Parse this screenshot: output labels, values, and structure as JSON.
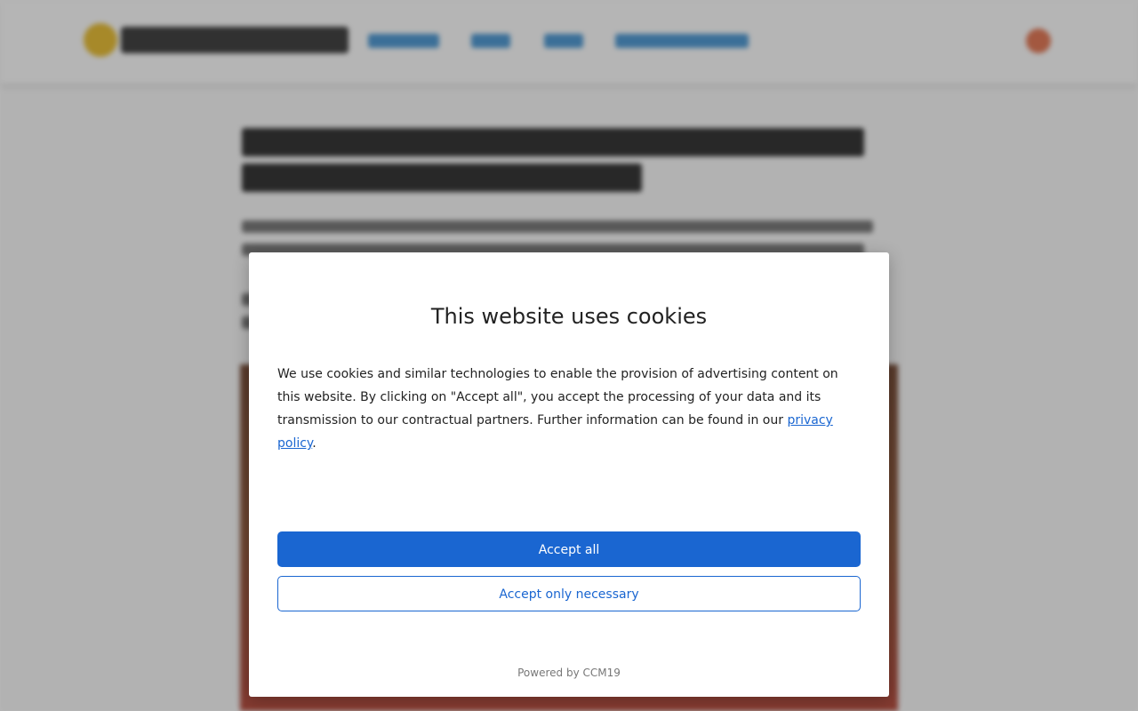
{
  "cookie_dialog": {
    "title": "This website uses cookies",
    "body_text": "We use cookies and similar technologies to enable the provision of advertising content on this website. By clicking on \"Accept all\", you accept the processing of your data and its transmission to our contractual partners. Further information can be found in our ",
    "privacy_link": "privacy policy",
    "body_end": ".",
    "accept_all_label": "Accept all",
    "accept_necessary_label": "Accept only necessary",
    "powered_by": "Powered by CCM19"
  },
  "colors": {
    "primary": "#1a66d1",
    "overlay": "rgba(60,60,60,0.38)"
  }
}
